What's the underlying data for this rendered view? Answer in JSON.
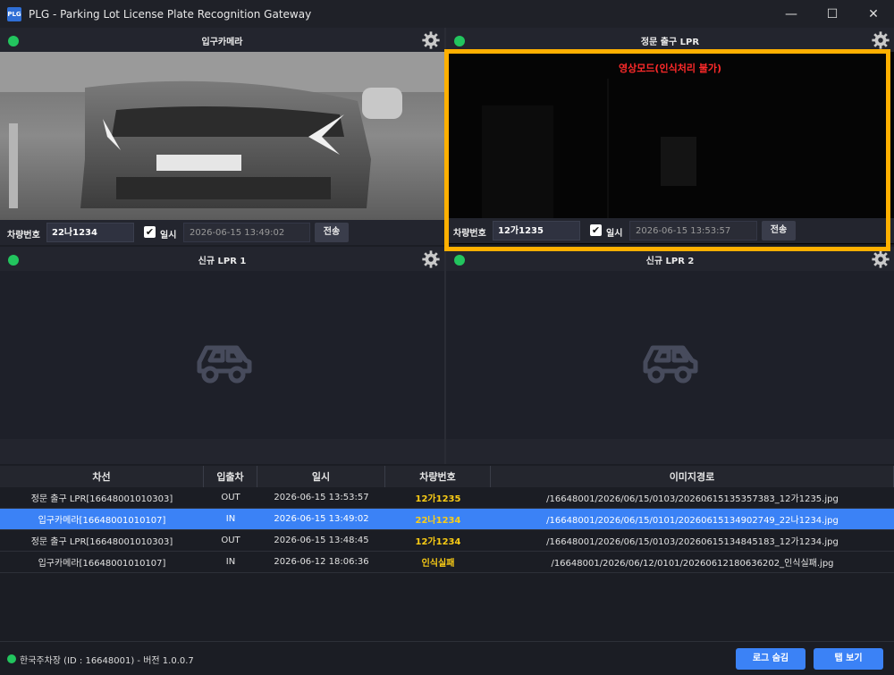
{
  "window": {
    "logo_text": "PLG",
    "title": "PLG - Parking Lot License Plate Recognition Gateway",
    "minimize": "—",
    "maximize": "☐",
    "close": "✕"
  },
  "panels": [
    {
      "title": "입구카메라",
      "status": "online",
      "has_feed": true,
      "controls": {
        "plate_label": "차량번호",
        "plate_value": "22나1234",
        "datetime_label": "일시",
        "datetime_checked": true,
        "datetime_value": "2026-06-15 13:49:02",
        "send_label": "전송"
      }
    },
    {
      "title": "정문 출구 LPR",
      "status": "online",
      "has_feed": true,
      "overlay_text": "영상모드(인식처리 불가)",
      "controls": {
        "plate_label": "차량번호",
        "plate_value": "12가1235",
        "datetime_label": "일시",
        "datetime_checked": true,
        "datetime_value": "2026-06-15 13:53:57",
        "send_label": "전송"
      }
    },
    {
      "title": "신규 LPR 1",
      "status": "online",
      "has_feed": false
    },
    {
      "title": "신규 LPR 2",
      "status": "online",
      "has_feed": false
    }
  ],
  "grid": {
    "columns": [
      "차선",
      "입출차",
      "일시",
      "차량번호",
      "이미지경로"
    ],
    "rows": [
      {
        "lane": "정문 출구 LPR[16648001010303]",
        "direction": "OUT",
        "datetime": "2026-06-15 13:53:57",
        "plate": "12가1235",
        "image_path": "/16648001/2026/06/15/0103/20260615135357383_12가1235.jpg",
        "selected": false
      },
      {
        "lane": "입구카메라[16648001010107]",
        "direction": "IN",
        "datetime": "2026-06-15 13:49:02",
        "plate": "22나1234",
        "image_path": "/16648001/2026/06/15/0101/20260615134902749_22나1234.jpg",
        "selected": true
      },
      {
        "lane": "정문 출구 LPR[16648001010303]",
        "direction": "OUT",
        "datetime": "2026-06-15 13:48:45",
        "plate": "12가1234",
        "image_path": "/16648001/2026/06/15/0103/20260615134845183_12가1234.jpg",
        "selected": false
      },
      {
        "lane": "입구카메라[16648001010107]",
        "direction": "IN",
        "datetime": "2026-06-12 18:06:36",
        "plate": "인식실패",
        "image_path": "/16648001/2026/06/12/0101/20260612180636202_인식실패.jpg",
        "selected": false
      }
    ]
  },
  "statusbar": {
    "text": "한국주차장 (ID : 16648001) - 버전 1.0.0.7",
    "hide_log_label": "로그 숨김",
    "tab_view_label": "탭 보기"
  },
  "colors": {
    "accent": "#3b82f6",
    "status_online": "#22c55e",
    "highlight_frame": "#ffb000",
    "overlay_text": "#ff2a2a",
    "plate_text": "#facc15"
  }
}
